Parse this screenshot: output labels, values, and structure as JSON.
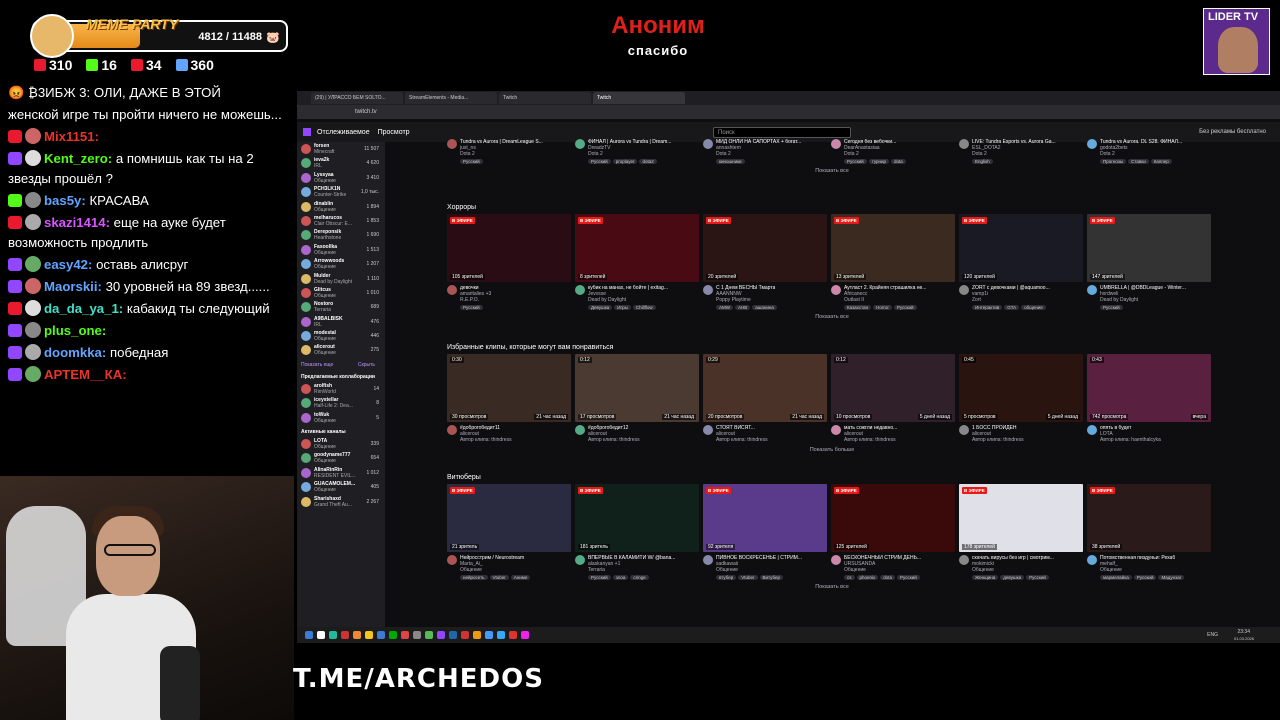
{
  "overlay": {
    "meme_title": "MEME PARTY",
    "meme_count": "4812 / 11488",
    "meme_progress": 0.42,
    "stats": [
      {
        "icon": "gift-icon",
        "value": "310",
        "color": "#e9192e"
      },
      {
        "icon": "kick-icon",
        "value": "16",
        "color": "#53fc18"
      },
      {
        "icon": "live-icon",
        "value": "34",
        "color": "#e9192e"
      },
      {
        "icon": "user-icon",
        "value": "360",
        "color": "#62a4ff"
      }
    ],
    "alert_name": "Аноним",
    "alert_text": "спасибо",
    "logo_text": "LIDER TV",
    "telegram": "T.ME/ARCHEDOS"
  },
  "chat": [
    {
      "text": "😡 ₿3ИБЖ 3: ОЛИ, ДАЖЕ В ЭТОЙ",
      "user": "",
      "color": "#fff"
    },
    {
      "text": "женской игре ты пройти ничего не можешь...",
      "user": "",
      "color": "#fff"
    },
    {
      "user": "Mix1151:",
      "text": "",
      "color": "#e9342c"
    },
    {
      "user": "Kent_zero:",
      "text": "а помнишь как ты на 2 звезды прошёл ?",
      "color": "#53fc18"
    },
    {
      "user": "bas5y:",
      "text": "КРАСАВА",
      "color": "#62a4ff"
    },
    {
      "user": "skazi1414:",
      "text": "еще на ауке будет возможность продлить",
      "color": "#d855ff"
    },
    {
      "user": "easy42:",
      "text": "оставь алисруг",
      "color": "#62a4ff"
    },
    {
      "user": "Maorskii:",
      "text": "30 уровней на 89 звезд......",
      "color": "#62a4ff"
    },
    {
      "user": "da_da_ya_1:",
      "text": "кабакид ты следующий",
      "color": "#42e0c8"
    },
    {
      "user": "plus_one:",
      "text": "",
      "color": "#53fc18"
    },
    {
      "user": "doomkka:",
      "text": "победная",
      "color": "#62a4ff"
    },
    {
      "user": "АРТЕМ__КА:",
      "text": "",
      "color": "#e9342c"
    }
  ],
  "browser": {
    "tabs": [
      "(29) | УЛРАССО БЕМ SOLTO...",
      "StreamElements - Media...",
      "Twitch",
      "Twitch"
    ],
    "url": "twitch.tv",
    "nav": [
      "Отслеживаемое",
      "Просмотр"
    ],
    "search_placeholder": "Поиск",
    "ad_free": "Без рекламы бесплатно",
    "sidebar": [
      {
        "name": "forsen",
        "game": "Minecraft",
        "v": "11 507"
      },
      {
        "name": "ieva2k",
        "game": "IRL",
        "v": "4 620"
      },
      {
        "name": "Lyssyaa",
        "game": "Общение",
        "v": "3 410"
      },
      {
        "name": "PCH3LK1N",
        "game": "Counter-Strike",
        "v": "1,0 тыс."
      },
      {
        "name": "dinablin",
        "game": "Общение",
        "v": "1 894"
      },
      {
        "name": "melharucos",
        "game": "Clair Obscur: E...",
        "v": "1 853"
      },
      {
        "name": "Dereponsik",
        "game": "Hearthstone",
        "v": "1 690"
      },
      {
        "name": "Fasoollka",
        "game": "Общение",
        "v": "1 513"
      },
      {
        "name": "Arrowwoods",
        "game": "Общение",
        "v": "1 207"
      },
      {
        "name": "Mulder",
        "game": "Dead by Daylight",
        "v": "1 110"
      },
      {
        "name": "Glitcus",
        "game": "Общение",
        "v": "1 010"
      },
      {
        "name": "Nostoro",
        "game": "Terraria",
        "v": "689"
      },
      {
        "name": "A9BALBISK",
        "game": "IRL",
        "v": "476"
      },
      {
        "name": "modestal",
        "game": "Общение",
        "v": "446"
      },
      {
        "name": "alicerout",
        "game": "Общение",
        "v": "275"
      }
    ],
    "sidebar_more": "Показать еще",
    "sidebar_hide": "Скрыть",
    "suggested_head": "Предлагаемые коллаборации",
    "suggested": [
      {
        "name": "arolfish",
        "game": "RimWorld",
        "v": "14"
      },
      {
        "name": "iceystellar",
        "game": "Half-Life 2: Dea...",
        "v": "8"
      },
      {
        "name": "toWuk",
        "game": "Общение",
        "v": "5"
      }
    ],
    "active_head": "Активные каналы",
    "active": [
      {
        "name": "LOTA",
        "game": "Общение",
        "v": "339"
      },
      {
        "name": "goodyname777",
        "game": "Общение",
        "v": "654"
      },
      {
        "name": "AlinaRinRin",
        "game": "RESIDENT EVIL...",
        "v": "1 012"
      },
      {
        "name": "GUACAMOLEM...",
        "game": "Общение",
        "v": "405"
      },
      {
        "name": "Sharishaxd",
        "game": "Grand Theft Au...",
        "v": "2 267"
      }
    ],
    "top_row": [
      {
        "t": "Tundra vs Aurora | DreamLeague S...",
        "c": "just_ns",
        "g": "Dota 2",
        "tags": [
          "Русский"
        ]
      },
      {
        "t": "ФИНАЛ | Aurora vs Tundra | Dream...",
        "c": "DreadzTV",
        "g": "Dota 2",
        "tags": [
          "Русский",
          "proplayer",
          "dota2"
        ]
      },
      {
        "t": "МИД ОНЛИ НА САПОРТАХ + богат...",
        "c": "annashtern",
        "g": "Dota 2",
        "tags": [
          "киношники"
        ]
      },
      {
        "t": "Сегодня без вебочки...",
        "c": "DearAnastasiaa",
        "g": "Dota 2",
        "tags": [
          "Русский",
          "турнир",
          "dota"
        ]
      },
      {
        "t": "LIVE: Tundra Esports vs. Aurora Ga...",
        "c": "ESL_DOTA2",
        "g": "Dota 2",
        "tags": [
          "English"
        ]
      },
      {
        "t": "Tundra vs Aurora. DL S28. ФИНАЛ...",
        "c": "godota2bets",
        "g": "Dota 2",
        "tags": [
          "Прогнозы",
          "Ставки",
          "Каппер"
        ]
      }
    ],
    "horror_title": "Хорроры",
    "horror": [
      {
        "vw": "105 зрителей",
        "t": "девочки",
        "c": "amaritalies +3",
        "g": "R.E.P.O.",
        "tags": [
          "Русский"
        ]
      },
      {
        "vw": "8 зрителей",
        "t": "кубик на манах, не бойте | exitag...",
        "c": "Jevvsse",
        "g": "Dead by Daylight",
        "tags": [
          "Девушка",
          "Игры",
          "Chillflow"
        ]
      },
      {
        "vw": "20 зрителей",
        "t": "С 1 Днем ВЕСНЫ Тмарта",
        "c": "AAANNNW",
        "g": "Poppy Playtime",
        "tags": [
          "AMW",
          "AHB",
          "ашанина"
        ]
      },
      {
        "vw": "13 зрителей",
        "t": "Аутласт 2. Крайняя страшилка не...",
        "c": "Africanecc",
        "g": "Outlast II",
        "tags": [
          "Казахстан",
          "Horror",
          "Русский"
        ]
      },
      {
        "vw": "120 зрителей",
        "t": "ZORT с девочками | @aquamoo...",
        "c": "vamp1i",
        "g": "Zort",
        "tags": [
          "Интерактив",
          "GTA",
          "общение"
        ]
      },
      {
        "vw": "147 зрителей",
        "t": "UMBRELLA | @DBDLeague - Winter...",
        "c": "hxrdweli",
        "g": "Dead by Daylight",
        "tags": [
          "Русский"
        ]
      }
    ],
    "clips_title": "Избранные клипы, которые могут вам понравиться",
    "clips": [
      {
        "dur": "0:30",
        "vw": "30 просмотров",
        "ago": "21 час назад",
        "t": "#доброгобедит11",
        "c": "alicerout",
        "a": "Автор клипа: thindress"
      },
      {
        "dur": "0:12",
        "vw": "17 просмотров",
        "ago": "21 час назад",
        "t": "#доброгобедит12",
        "c": "alicerout",
        "a": "Автор клипа: thindress"
      },
      {
        "dur": "0:29",
        "vw": "20 просмотров",
        "ago": "21 час назад",
        "t": "СТОЯТ ВИСЯТ...",
        "c": "alicerout",
        "a": "Автор клипа: thindress"
      },
      {
        "dur": "0:12",
        "vw": "10 просмотров",
        "ago": "5 дней назад",
        "t": "мать сожгли недавно...",
        "c": "alicerout",
        "a": "Автор клипа: thindress"
      },
      {
        "dur": "0:45",
        "vw": "5 просмотров",
        "ago": "5 дней назад",
        "t": "1 БОСС ПРОЙДЕН",
        "c": "alicerout",
        "a": "Автор клипа: thindress"
      },
      {
        "dur": "0:43",
        "vw": "742 просмотра",
        "ago": "вчера",
        "t": "опять в будет",
        "c": "LOTA",
        "a": "Автор клипа: haenthalcyka"
      }
    ],
    "vtube_title": "Витюберы",
    "vtube": [
      {
        "vw": "21 зритель",
        "t": "Нейросстрим / Neurostream",
        "c": "Marta_Ai_",
        "g": "Общение",
        "tags": [
          "нейросеть",
          "Vtuber",
          "Аниме"
        ]
      },
      {
        "vw": "181 зритель",
        "t": "ВПЕРВЫЕ В КАЛАМИТИ W/ @bana...",
        "c": "alaskanyan +1",
        "g": "Terraria",
        "tags": [
          "Русский",
          "злоа",
          "cringe"
        ]
      },
      {
        "vw": "92 зрителя",
        "t": "ПИВНОЕ ВОСКРЕСЕНЬЕ | СТРИМ...",
        "c": "sadkawaii",
        "g": "Общение",
        "tags": [
          "втубер",
          "Vtuber",
          "Витубер"
        ]
      },
      {
        "vw": "125 зрителей",
        "t": "БЕСКОНЕЧНЫЙ СТРИМ ДЕНЬ...",
        "c": "URSUSANDA",
        "g": "Общение",
        "tags": [
          "cs",
          "phoenix",
          "dota",
          "Русский"
        ]
      },
      {
        "vw": "178 зрителей",
        "t": "скачать вирусы без игр | смотрим...",
        "c": "mokimicki",
        "g": "Общение",
        "tags": [
          "Женщина",
          "девушка",
          "Русский"
        ]
      },
      {
        "vw": "38 зрителей",
        "t": "Потомственная пиздуньи: Рехаб",
        "c": "mehalf_",
        "g": "Общение",
        "tags": [
          "мармелайка",
          "Русский",
          "Мадунзаг"
        ]
      }
    ],
    "show_all": "Показать все",
    "show_more": "Показать больше",
    "live": "В ЭФИРЕ",
    "clock": "23:34",
    "date": "01.03.2026",
    "lang": "ENG"
  }
}
